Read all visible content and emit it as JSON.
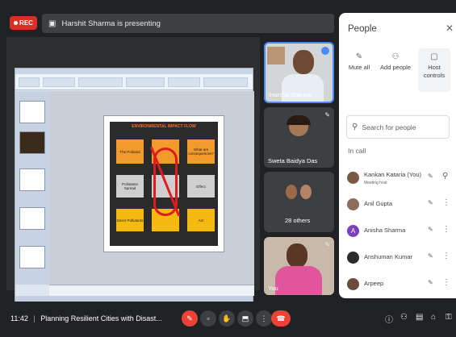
{
  "recording": {
    "label": "REC"
  },
  "presenter_bar": {
    "text": "Harshit Sharma is presenting"
  },
  "slide": {
    "heading": "ENVIRONMENTAL IMPACT FLOW",
    "boxes": [
      {
        "text": "The Polluted",
        "color": "#f39a2c"
      },
      {
        "text": "",
        "color": "#f39a2c"
      },
      {
        "text": "What are consequences?",
        "color": "#f39a2c"
      },
      {
        "text": "Pollutants Spread",
        "color": "#cfcfcf"
      },
      {
        "text": "",
        "color": "#cfcfcf"
      },
      {
        "text": "Effect",
        "color": "#cfcfcf"
      },
      {
        "text": "Direct Pollutants",
        "color": "#f5b90f"
      },
      {
        "text": "",
        "color": "#f5b90f"
      },
      {
        "text": "Act",
        "color": "#f5b90f"
      }
    ]
  },
  "tiles": [
    {
      "name": "Harshit Sharma"
    },
    {
      "name": "Sweta Baidya Das"
    },
    {
      "name": "28 others"
    },
    {
      "name": "You"
    }
  ],
  "people_panel": {
    "title": "People",
    "actions": [
      {
        "label": "Mute all",
        "icon": "mic-off-icon"
      },
      {
        "label": "Add people",
        "icon": "add-person-icon"
      },
      {
        "label": "Host controls",
        "icon": "host-controls-icon"
      }
    ],
    "search_placeholder": "Search for people",
    "section_label": "In call",
    "people": [
      {
        "name": "Kankan Kataria (You)",
        "sub": "Meeting host",
        "avatar_color": "#7a5a44"
      },
      {
        "name": "Anil Gupta",
        "sub": "",
        "avatar_color": "#8a6d5a"
      },
      {
        "name": "Anisha Sharma",
        "sub": "",
        "avatar_color": "#7b3fbf",
        "initial": "A"
      },
      {
        "name": "Anshuman Kumar",
        "sub": "",
        "avatar_color": "#2b2b2b"
      },
      {
        "name": "Arpeep",
        "sub": "",
        "avatar_color": "#6b4b3a"
      }
    ]
  },
  "bottom_bar": {
    "time": "11:42",
    "separator": "|",
    "meeting_title": "Planning Resilient Cities with Disast..."
  },
  "colors": {
    "background": "#202124",
    "recording": "#d93025",
    "danger": "#ea4335",
    "panel": "#ffffff"
  }
}
